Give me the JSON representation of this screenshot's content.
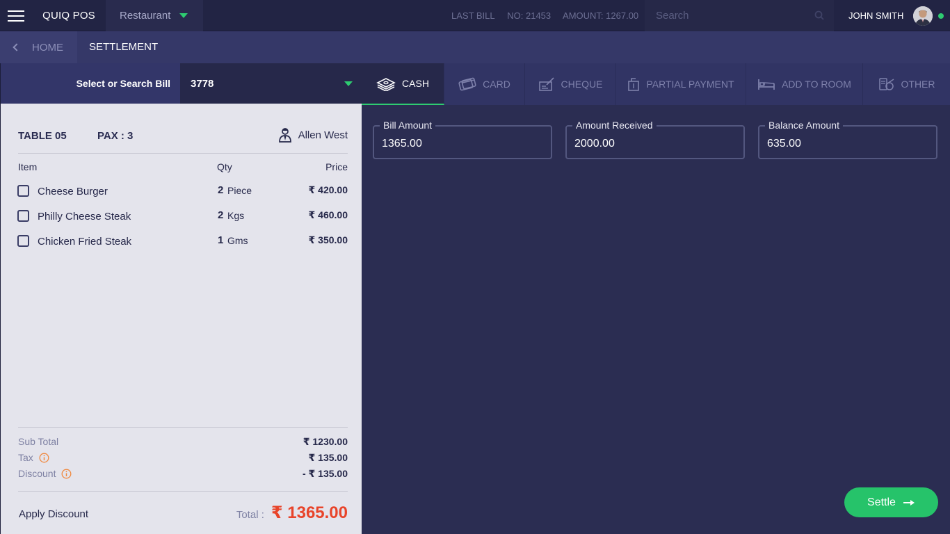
{
  "header": {
    "brand": "QUIQ POS",
    "outlet": "Restaurant",
    "last_bill_label": "LAST BILL",
    "last_bill_no": "NO: 21453",
    "last_bill_amount": "AMOUNT: 1267.00",
    "search_placeholder": "Search",
    "user_name": "JOHN SMITH"
  },
  "breadcrumb": {
    "home": "HOME",
    "current": "SETTLEMENT"
  },
  "bill_select": {
    "label": "Select or Search Bill",
    "value": "3778"
  },
  "payment_tabs": [
    {
      "label": "CASH",
      "active": true
    },
    {
      "label": "CARD",
      "active": false
    },
    {
      "label": "CHEQUE",
      "active": false
    },
    {
      "label": "PARTIAL PAYMENT",
      "active": false
    },
    {
      "label": "ADD TO ROOM",
      "active": false
    },
    {
      "label": "OTHER",
      "active": false
    }
  ],
  "bill": {
    "table": "TABLE 05",
    "pax": "PAX : 3",
    "waiter": "Allen West",
    "columns": {
      "item": "Item",
      "qty": "Qty",
      "price": "Price"
    },
    "items": [
      {
        "name": "Cheese Burger",
        "qty": "2",
        "unit": "Piece",
        "price": "₹ 420.00",
        "checked": false
      },
      {
        "name": "Philly Cheese Steak",
        "qty": "2",
        "unit": "Kgs",
        "price": "₹ 460.00",
        "checked": false
      },
      {
        "name": "Chicken Fried Steak",
        "qty": "1",
        "unit": "Gms",
        "price": "₹ 350.00",
        "checked": false
      }
    ],
    "subtotal_label": "Sub Total",
    "subtotal": "₹ 1230.00",
    "tax_label": "Tax",
    "tax": "₹ 135.00",
    "discount_label": "Discount",
    "discount": "- ₹ 135.00",
    "apply_discount": "Apply Discount",
    "total_label": "Total  :",
    "total": "₹ 1365.00"
  },
  "amounts": {
    "bill_amount_label": "Bill Amount",
    "bill_amount": "1365.00",
    "amount_received_label": "Amount Received",
    "amount_received": "2000.00",
    "balance_amount_label": "Balance Amount",
    "balance_amount": "635.00"
  },
  "actions": {
    "settle": "Settle"
  },
  "colors": {
    "accent_green": "#2ecc71",
    "total_red": "#e8442a",
    "info_orange": "#f0883e"
  }
}
